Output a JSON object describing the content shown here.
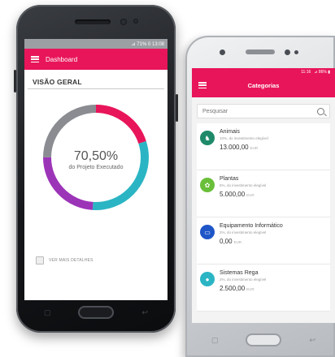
{
  "dashboard_phone": {
    "status_text": "⊿ 71% 0 13:08",
    "appbar_title": "Dashboard",
    "section_title": "VISÃO GERAL",
    "donut": {
      "value_text": "70,50%",
      "caption": "do Projeto Executado",
      "segments": [
        {
          "fraction": 0.2,
          "color": "#e8155a"
        },
        {
          "fraction": 0.31,
          "color": "#2bb5c4"
        },
        {
          "fraction": 0.24,
          "color": "#9c34b8"
        },
        {
          "fraction": 0.25,
          "color": "#8a8c92"
        }
      ]
    },
    "details_label": "VER MAIS DETALHES",
    "nav_keys": {
      "recent": "▢",
      "back": "↩"
    }
  },
  "categories_phone": {
    "status_text": "11:16",
    "status_right": "⊿ 86% ▮",
    "appbar_title": "Categorias",
    "search": {
      "placeholder": "Pesquisar"
    },
    "items": [
      {
        "name": "Animais",
        "sub": "10%, do investimento elegível",
        "amount": "13.000,00",
        "unit": "EUR",
        "color": "#1f8a6a",
        "icon": "paw-icon",
        "glyph": "♞"
      },
      {
        "name": "Plantas",
        "sub": "5%, do investimento elegível",
        "amount": "5.000,00",
        "unit": "EUR",
        "color": "#6abf3a",
        "icon": "plant-icon",
        "glyph": "✿"
      },
      {
        "name": "Equipamento Informático",
        "sub": "2%, do investimento elegível",
        "amount": "0,00",
        "unit": "EUR",
        "color": "#1e56c8",
        "icon": "computer-icon",
        "glyph": "▭"
      },
      {
        "name": "Sistemas Rega",
        "sub": "2%, do investimento elegível",
        "amount": "2.500,00",
        "unit": "EUR",
        "color": "#2bb5c4",
        "icon": "water-drop-icon",
        "glyph": "●"
      }
    ],
    "nav_keys": {
      "recent": "▢",
      "back": "↩"
    }
  },
  "colors": {
    "accent": "#e8155a"
  }
}
